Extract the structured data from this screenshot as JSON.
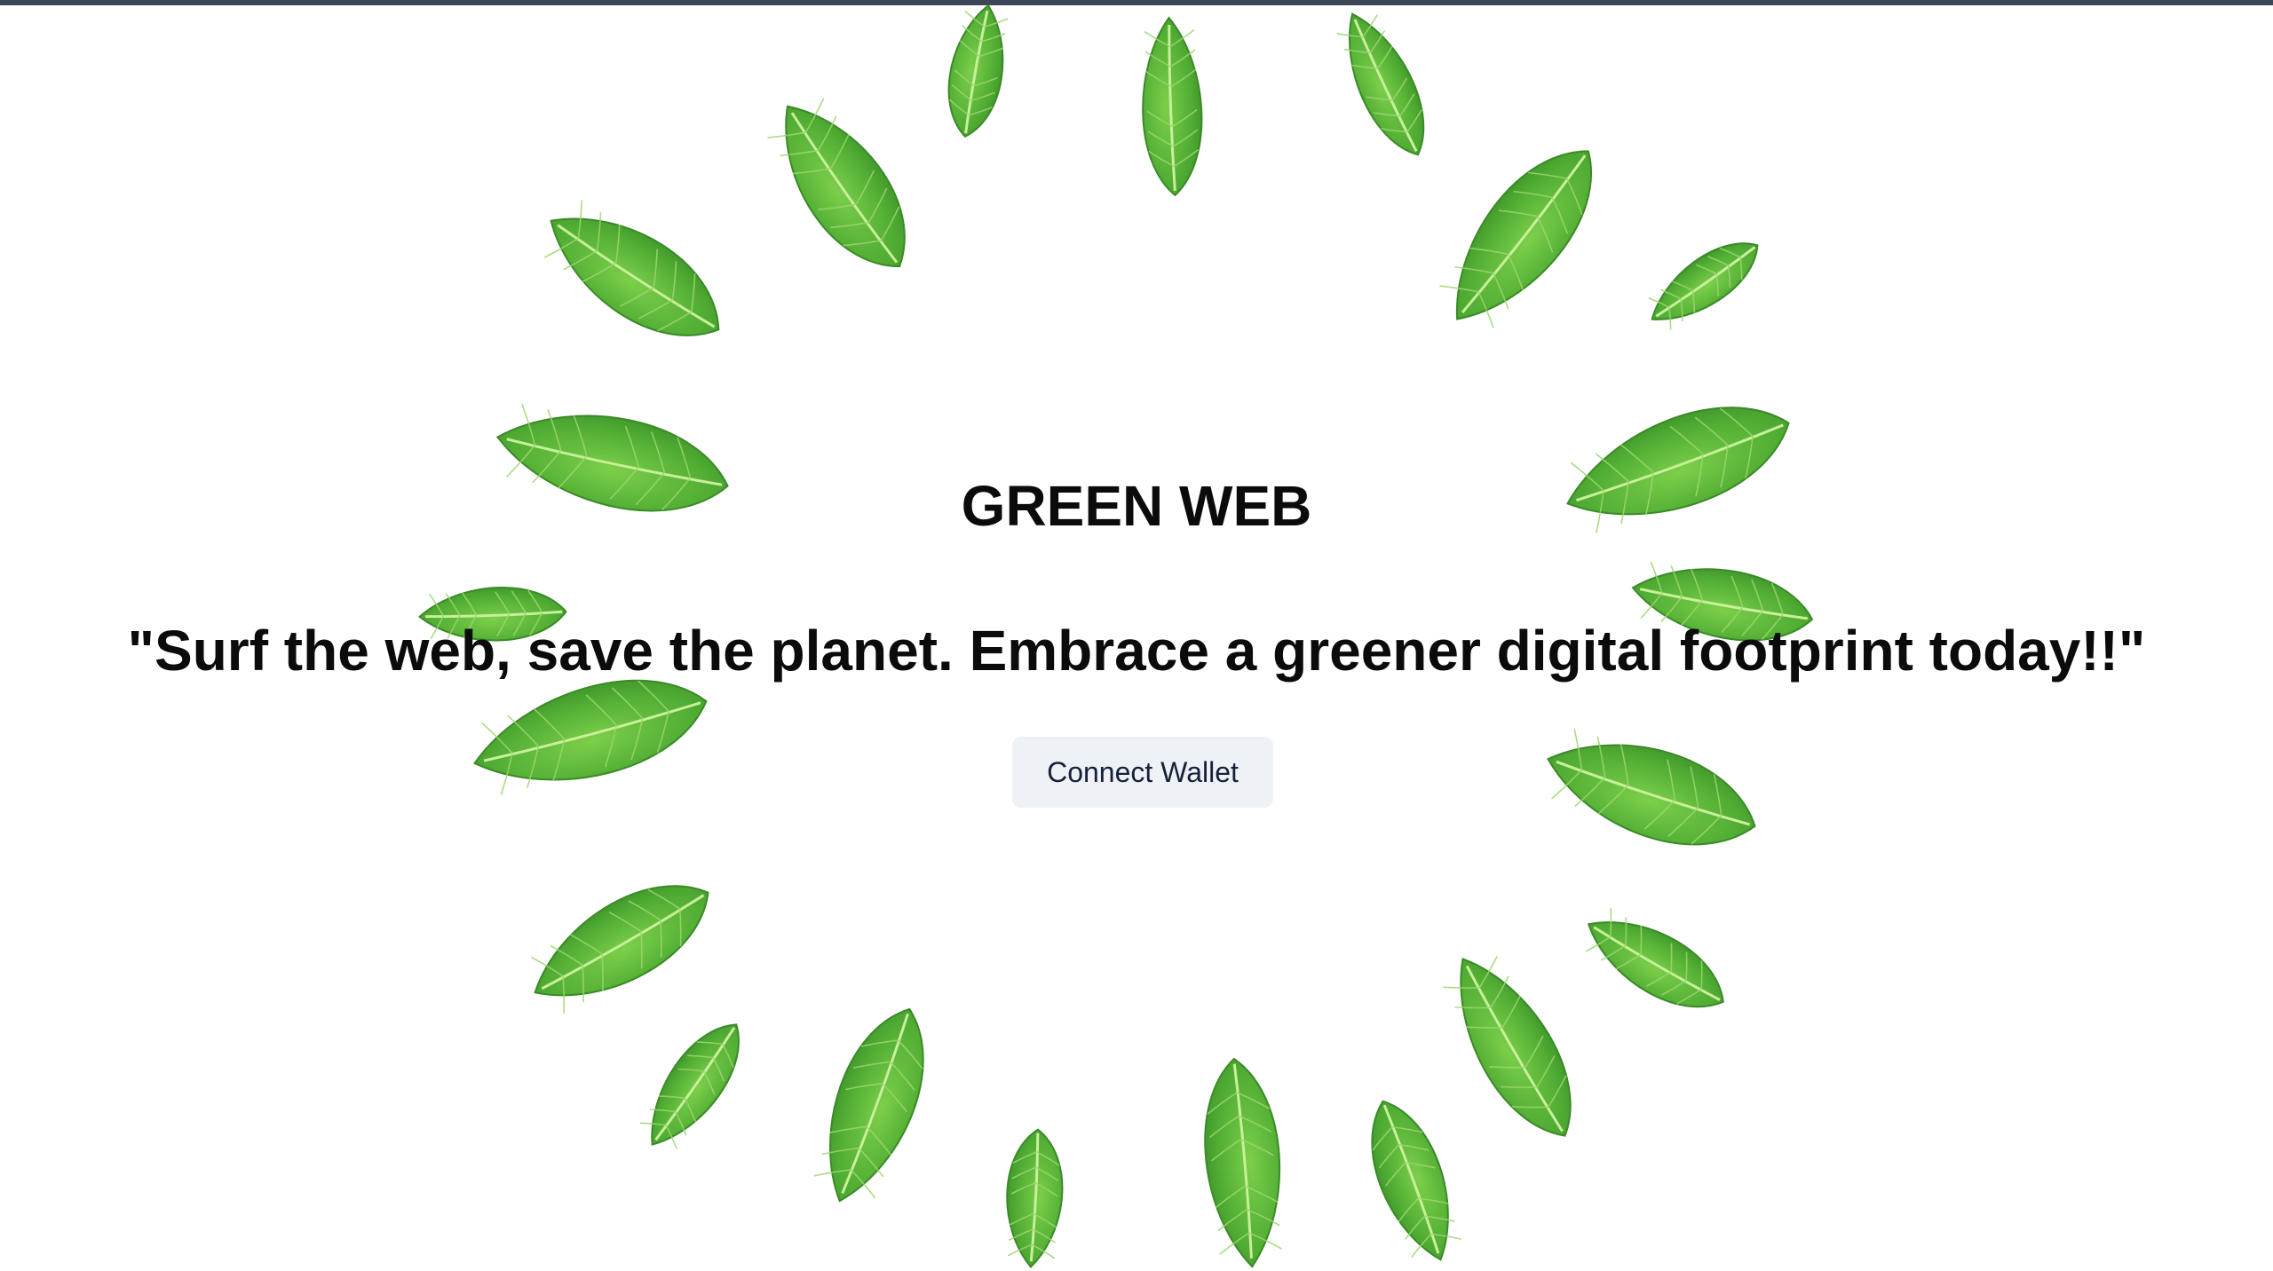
{
  "hero": {
    "title": "GREEN WEB",
    "tagline": "\"Surf the web, save the planet. Embrace a greener digital footprint today!!\"",
    "connect_button_label": "Connect Wallet"
  },
  "colors": {
    "background": "#ffffff",
    "top_bar": "#3d4658",
    "leaf_dark": "#3f9b2c",
    "leaf_light": "#7ccf4a",
    "button_bg": "#eef1f6",
    "button_text": "#16203a",
    "text": "#0b0b0b"
  },
  "decor": {
    "background_image": "mint-leaf-wreath"
  }
}
